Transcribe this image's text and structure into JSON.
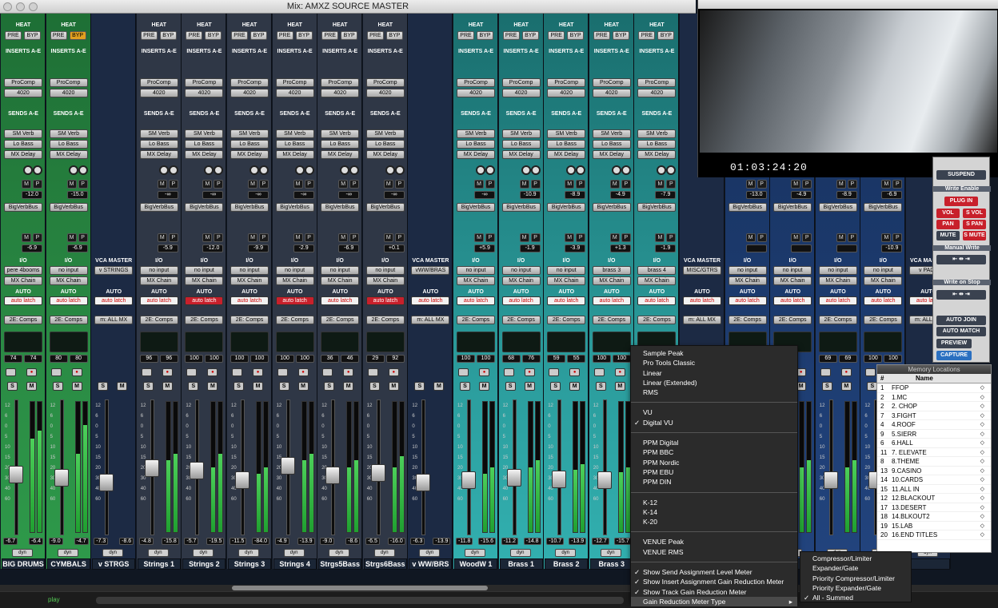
{
  "window": {
    "title": "Mix: AMXZ SOURCE MASTER"
  },
  "labels": {
    "heat": "HEAT",
    "pre": "PRE",
    "byp": "BYP",
    "inserts": "INSERTS A-E",
    "sends": "SENDS A-E",
    "io": "I/O",
    "auto": "AUTO",
    "vca_master": "VCA MASTER",
    "dyn": "dyn",
    "m": "M",
    "p": "P",
    "s": "S"
  },
  "strips": [
    {
      "name": "BIG DRUMS",
      "color": "g",
      "in1": "ProComp",
      "in2": "4020",
      "s1": "SM Verb",
      "s2": "Lo Bass",
      "s3": "MX Delay",
      "bus1": "BigVerbBus",
      "bus1val": "-12.0",
      "bus2val": "-6.9",
      "input": "pere 4booms",
      "output": "MX Chain",
      "auto": "auto latch",
      "autored": false,
      "group": "2E: Comps",
      "mv": [
        "74",
        "74"
      ],
      "vol": [
        "-6.7",
        "-6.4"
      ],
      "meter": [
        0.72,
        0.78
      ],
      "fader": 0.45,
      "byp": false
    },
    {
      "name": "CYMBALS",
      "color": "g",
      "in1": "ProComp",
      "in2": "4020",
      "s1": "SM Verb",
      "s2": "Lo Bass",
      "s3": "MX Delay",
      "bus1": "BigVerbBus",
      "bus1val": "-15.0",
      "bus2val": "-6.9",
      "input": "no input",
      "output": "MX Chain",
      "auto": "auto latch",
      "autored": false,
      "group": "2E: Comps",
      "mv": [
        "80",
        "80"
      ],
      "vol": [
        "-9.0",
        "-4.7"
      ],
      "meter": [
        0.6,
        0.82
      ],
      "fader": 0.42,
      "byp": true
    },
    {
      "name": "v STRGS",
      "color": "vca",
      "vca": true,
      "input": "v STRINGS",
      "auto": "auto latch",
      "autored": false,
      "group": "m: ALL MX",
      "vol": [
        "-7.3",
        "-8.6"
      ],
      "fader": 0.38
    },
    {
      "name": "Strings 1",
      "color": "gy",
      "in1": "ProComp",
      "in2": "4020",
      "s1": "SM Verb",
      "s2": "Lo Bass",
      "s3": "MX Delay",
      "bus1": "BigVerbBus",
      "bus1val": "-∞",
      "bus2val": "-5.9",
      "input": "no input",
      "output": "MX Chain",
      "auto": "auto latch",
      "autored": false,
      "group": "2E: Comps",
      "mv": [
        "96",
        "96"
      ],
      "vol": [
        "-4.8",
        "-15.8"
      ],
      "meter": [
        0.55,
        0.6
      ],
      "fader": 0.5,
      "byp": false
    },
    {
      "name": "Strings 2",
      "color": "gy",
      "in1": "ProComp",
      "in2": "4020",
      "s1": "SM Verb",
      "s2": "Lo Bass",
      "s3": "MX Delay",
      "bus1": "BigVerbBus",
      "bus1val": "-∞",
      "bus2val": "-12.0",
      "input": "no input",
      "output": "MX Chain",
      "auto": "auto latch",
      "autored": true,
      "group": "2E: Comps",
      "mv": [
        "100",
        "100"
      ],
      "vol": [
        "-5.7",
        "-19.5"
      ],
      "meter": [
        0.5,
        0.6
      ],
      "fader": 0.48,
      "byp": false
    },
    {
      "name": "Strings 3",
      "color": "gy",
      "in1": "ProComp",
      "in2": "4020",
      "s1": "SM Verb",
      "s2": "Lo Bass",
      "s3": "MX Delay",
      "bus1": "BigVerbBus",
      "bus1val": "-∞",
      "bus2val": "-9.9",
      "input": "no input",
      "output": "MX Chain",
      "auto": "auto latch",
      "autored": false,
      "group": "2E: Comps",
      "mv": [
        "100",
        "100"
      ],
      "vol": [
        "-11.5",
        "-84.0"
      ],
      "meter": [
        0.45,
        0.5
      ],
      "fader": 0.4,
      "byp": false
    },
    {
      "name": "Strings 4",
      "color": "gy",
      "in1": "ProComp",
      "in2": "4020",
      "s1": "SM Verb",
      "s2": "Lo Bass",
      "s3": "MX Delay",
      "bus1": "BigVerbBus",
      "bus1val": "-∞",
      "bus2val": "-2.9",
      "input": "no input",
      "output": "MX Chain",
      "auto": "auto latch",
      "autored": true,
      "group": "2E: Comps",
      "mv": [
        "100",
        "100"
      ],
      "vol": [
        "-4.9",
        "-13.9"
      ],
      "meter": [
        0.55,
        0.6
      ],
      "fader": 0.52,
      "byp": false
    },
    {
      "name": "Strgs5Bass",
      "color": "gy",
      "in1": "ProComp",
      "in2": "4020",
      "s1": "SM Verb",
      "s2": "Lo Bass",
      "s3": "MX Delay",
      "bus1": "BigVerbBus",
      "bus1val": "-∞",
      "bus2val": "-6.9",
      "input": "no input",
      "output": "MX Chain",
      "auto": "auto latch",
      "autored": false,
      "group": "2E: Comps",
      "mv": [
        "36",
        "46"
      ],
      "vol": [
        "-9.0",
        "-8.6"
      ],
      "meter": [
        0.5,
        0.55
      ],
      "fader": 0.44,
      "byp": false
    },
    {
      "name": "Strgs6Bass",
      "color": "gy",
      "in1": "ProComp",
      "in2": "4020",
      "s1": "SM Verb",
      "s2": "Lo Bass",
      "s3": "MX Delay",
      "bus1": "BigVerbBus",
      "bus1val": "-∞",
      "bus2val": "+0.1",
      "input": "no input",
      "output": "MX Chain",
      "auto": "auto latch",
      "autored": true,
      "group": "2E: Comps",
      "mv": [
        "29",
        "92"
      ],
      "vol": [
        "-6.5",
        "-16.0"
      ],
      "meter": [
        0.5,
        0.58
      ],
      "fader": 0.46,
      "byp": false
    },
    {
      "name": "v WW/BRS",
      "color": "vca",
      "vca": true,
      "input": "vWW/BRAS",
      "auto": "auto latch",
      "autored": false,
      "group": "m: ALL MX",
      "vol": [
        "-6.3",
        "-13.9"
      ],
      "fader": 0.38
    },
    {
      "name": "WoodW 1",
      "color": "t",
      "in1": "ProComp",
      "in2": "4020",
      "s1": "SM Verb",
      "s2": "Lo Bass",
      "s3": "MX Delay",
      "bus1": "BigVerbBus",
      "bus1val": "-∞",
      "bus2val": "+5.9",
      "input": "no input",
      "output": "MX Chain",
      "auto": "auto latch",
      "autored": false,
      "group": "2E: Comps",
      "mv": [
        "100",
        "100"
      ],
      "vol": [
        "-11.8",
        "-15.6"
      ],
      "meter": [
        0.45,
        0.5
      ],
      "fader": 0.4,
      "byp": false
    },
    {
      "name": "Brass 1",
      "color": "t",
      "in1": "ProComp",
      "in2": "4020",
      "s1": "SM Verb",
      "s2": "Lo Bass",
      "s3": "MX Delay",
      "bus1": "BigVerbBus",
      "bus1val": "-10.9",
      "bus2val": "-1.9",
      "input": "no input",
      "output": "MX Chain",
      "auto": "auto latch",
      "autored": false,
      "group": "2E: Comps",
      "mv": [
        "68",
        "76"
      ],
      "vol": [
        "-11.2",
        "-14.8"
      ],
      "meter": [
        0.5,
        0.55
      ],
      "fader": 0.42,
      "byp": false
    },
    {
      "name": "Brass 2",
      "color": "t",
      "in1": "ProComp",
      "in2": "4020",
      "s1": "SM Verb",
      "s2": "Lo Bass",
      "s3": "MX Delay",
      "bus1": "BigVerbBus",
      "bus1val": "-8.9",
      "bus2val": "-3.9",
      "input": "no input",
      "output": "MX Chain",
      "auto": "auto latch",
      "autored": false,
      "group": "2E: Comps",
      "mv": [
        "59",
        "55"
      ],
      "vol": [
        "-10.7",
        "-13.9"
      ],
      "meter": [
        0.48,
        0.52
      ],
      "fader": 0.41,
      "byp": false
    },
    {
      "name": "Brass 3",
      "color": "t",
      "in1": "ProComp",
      "in2": "4020",
      "s1": "SM Verb",
      "s2": "Lo Bass",
      "s3": "MX Delay",
      "bus1": "BigVerbBus",
      "bus1val": "-4.9",
      "bus2val": "+1.3",
      "input": "brass 3",
      "output": "MX Chain",
      "auto": "auto latch",
      "autored": false,
      "group": "2E: Comps",
      "mv": [
        "100",
        "100"
      ],
      "vol": [
        "-12.7",
        "-15.7"
      ],
      "meter": [
        0.46,
        0.5
      ],
      "fader": 0.4,
      "byp": false
    },
    {
      "name": "",
      "color": "t",
      "in1": "ProComp",
      "in2": "4020",
      "s1": "SM Verb",
      "s2": "Lo Bass",
      "s3": "MX Delay",
      "bus1": "BigVerbBus",
      "bus1val": "-7.9",
      "bus2val": "-1.9",
      "input": "brass 4",
      "output": "MX Chain",
      "auto": "auto latch",
      "autored": false,
      "group": "2E: Comps",
      "mv": [
        "",
        ""
      ],
      "vol": [
        "",
        ""
      ],
      "meter": [
        0.4,
        0.45
      ],
      "fader": 0.4,
      "byp": false
    },
    {
      "name": "",
      "color": "vca",
      "vca": true,
      "input": "MISC/GTRS",
      "auto": "auto latch",
      "autored": false,
      "group": "m: ALL MX",
      "vol": [
        "",
        ""
      ],
      "fader": 0.38
    },
    {
      "name": "",
      "color": "b",
      "in1": "",
      "in2": "",
      "s1": "",
      "s2": "",
      "s3": "",
      "bus1": "BigVerbBus",
      "bus1val": "-13.0",
      "bus2val": "",
      "input": "no input",
      "output": "MX Chain",
      "auto": "auto latch",
      "autored": false,
      "group": "2E: Comps",
      "mv": [
        "",
        ""
      ],
      "vol": [
        "",
        ""
      ],
      "meter": [
        0.5,
        0.55
      ],
      "fader": 0.4,
      "byp": false
    },
    {
      "name": "",
      "color": "b",
      "in1": "",
      "in2": "",
      "s1": "",
      "s2": "",
      "s3": "",
      "bus1": "BigVerbBus",
      "bus1val": "-4.9",
      "bus2val": "",
      "input": "no input",
      "output": "MX Chain",
      "auto": "auto latch",
      "autored": false,
      "group": "2E: Comps",
      "mv": [
        "",
        ""
      ],
      "vol": [
        "",
        ""
      ],
      "meter": [
        0.5,
        0.55
      ],
      "fader": 0.4,
      "byp": false
    },
    {
      "name": "",
      "color": "b",
      "in1": "",
      "in2": "",
      "s1": "",
      "s2": "",
      "s3": "",
      "bus1": "BigVerbBus",
      "bus1val": "-8.9",
      "bus2val": "",
      "input": "no input",
      "output": "MX Chain",
      "auto": "auto latch",
      "autored": false,
      "group": "2E: Comps",
      "mv": [
        "69",
        "69"
      ],
      "vol": [
        "",
        ""
      ],
      "meter": [
        0.5,
        0.55
      ],
      "fader": 0.4,
      "byp": false
    },
    {
      "name": "",
      "color": "b",
      "in1": "",
      "in2": "",
      "s1": "",
      "s2": "",
      "s3": "",
      "bus1": "BigVerbBus",
      "bus1val": "-6.9",
      "bus2val": "-10.9",
      "input": "no input",
      "output": "MX Chain",
      "auto": "auto latch",
      "autored": false,
      "group": "2E: Comps",
      "mv": [
        "100",
        "100"
      ],
      "vol": [
        "",
        ""
      ],
      "meter": [
        0.5,
        0.55
      ],
      "fader": 0.4,
      "byp": false
    },
    {
      "name": "",
      "color": "vca",
      "vca": true,
      "input": "v PADS",
      "auto": "auto latch",
      "autored": false,
      "group": "m: ALL MX",
      "vol": [
        "",
        ""
      ],
      "fader": 0.38
    }
  ],
  "video": {
    "timecode": "01:03:24:20"
  },
  "transport": {
    "suspend": "SUSPEND",
    "write_enable": "Write Enable",
    "plug_in": "PLUG IN",
    "vol": "VOL",
    "s_vol": "S VOL",
    "pan": "PAN",
    "s_pan": "S PAN",
    "mute": "MUTE",
    "s_mute": "S MUTE",
    "manual_write": "Manual Write",
    "write_on_stop": "Write on Stop",
    "auto_join": "AUTO JOIN",
    "auto_match": "AUTO MATCH",
    "preview": "PREVIEW",
    "capture": "CAPTURE"
  },
  "memory": {
    "title": "Memory Locations",
    "col_num": "#",
    "col_name": "Name",
    "rows": [
      {
        "n": "1",
        "name": "FFOP"
      },
      {
        "n": "2",
        "name": "1.MC"
      },
      {
        "n": "2",
        "name": "2. CHOP"
      },
      {
        "n": "7",
        "name": "3.FIGHT"
      },
      {
        "n": "4",
        "name": "4.ROOF"
      },
      {
        "n": "9",
        "name": "5.SIERR"
      },
      {
        "n": "6",
        "name": "6.HALL"
      },
      {
        "n": "11",
        "name": "7. ELEVATE"
      },
      {
        "n": "8",
        "name": "8.THEME"
      },
      {
        "n": "13",
        "name": "9.CASINO"
      },
      {
        "n": "14",
        "name": "10.CARDS"
      },
      {
        "n": "15",
        "name": "11.ALL IN"
      },
      {
        "n": "12",
        "name": "12.BLACKOUT"
      },
      {
        "n": "17",
        "name": "13.DESERT"
      },
      {
        "n": "18",
        "name": "14.BLKOUT2"
      },
      {
        "n": "19",
        "name": "15.LAB"
      },
      {
        "n": "20",
        "name": "16.END TITLES"
      }
    ]
  },
  "menu": {
    "groups": [
      [
        {
          "label": "Sample Peak",
          "checked": false
        },
        {
          "label": "Pro Tools Classic",
          "checked": false
        },
        {
          "label": "Linear",
          "checked": false
        },
        {
          "label": "Linear (Extended)",
          "checked": false
        },
        {
          "label": "RMS",
          "checked": false
        }
      ],
      [
        {
          "label": "VU",
          "checked": false
        },
        {
          "label": "Digital VU",
          "checked": true
        }
      ],
      [
        {
          "label": "PPM Digital",
          "checked": false
        },
        {
          "label": "PPM BBC",
          "checked": false
        },
        {
          "label": "PPM Nordic",
          "checked": false
        },
        {
          "label": "PPM EBU",
          "checked": false
        },
        {
          "label": "PPM DIN",
          "checked": false
        }
      ],
      [
        {
          "label": "K-12",
          "checked": false
        },
        {
          "label": "K-14",
          "checked": false
        },
        {
          "label": "K-20",
          "checked": false
        }
      ],
      [
        {
          "label": "VENUE Peak",
          "checked": false
        },
        {
          "label": "VENUE RMS",
          "checked": false
        }
      ],
      [
        {
          "label": "Show Send Assignment Level Meter",
          "checked": true
        },
        {
          "label": "Show Insert Assignment Gain Reduction Meter",
          "checked": true
        },
        {
          "label": "Show Track Gain Reduction Meter",
          "checked": true
        },
        {
          "label": "Gain Reduction Meter Type",
          "checked": false,
          "submenu": true
        }
      ]
    ],
    "submenu": [
      {
        "label": "Compressor/Limiter",
        "checked": false
      },
      {
        "label": "Expander/Gate",
        "checked": false
      },
      {
        "label": "Priority Compressor/Limiter",
        "checked": false
      },
      {
        "label": "Priority Expander/Gate",
        "checked": false
      },
      {
        "label": "All - Summed",
        "checked": true
      }
    ]
  },
  "status": {
    "play": "play"
  }
}
